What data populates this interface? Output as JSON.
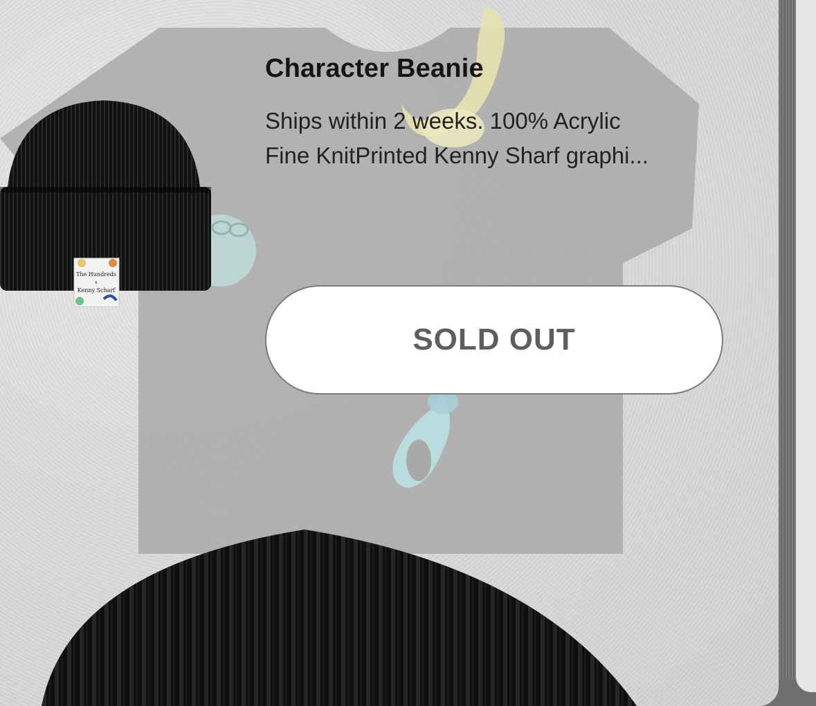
{
  "product": {
    "title": "Character Beanie",
    "description_line1": "Ships within 2 weeks. 100% Acrylic",
    "description_line2": "Fine KnitPrinted Kenny Sharf graphi...",
    "button_label": "SOLD OUT"
  },
  "patch": {
    "line1": "The Hundreds",
    "line2": "x",
    "line3": "Kenny Scharf"
  },
  "colors": {
    "button_text": "#5e5e5e",
    "title_text": "#151515",
    "beanie": "#121212",
    "tshirt_overlay": "#a9a9a9"
  }
}
